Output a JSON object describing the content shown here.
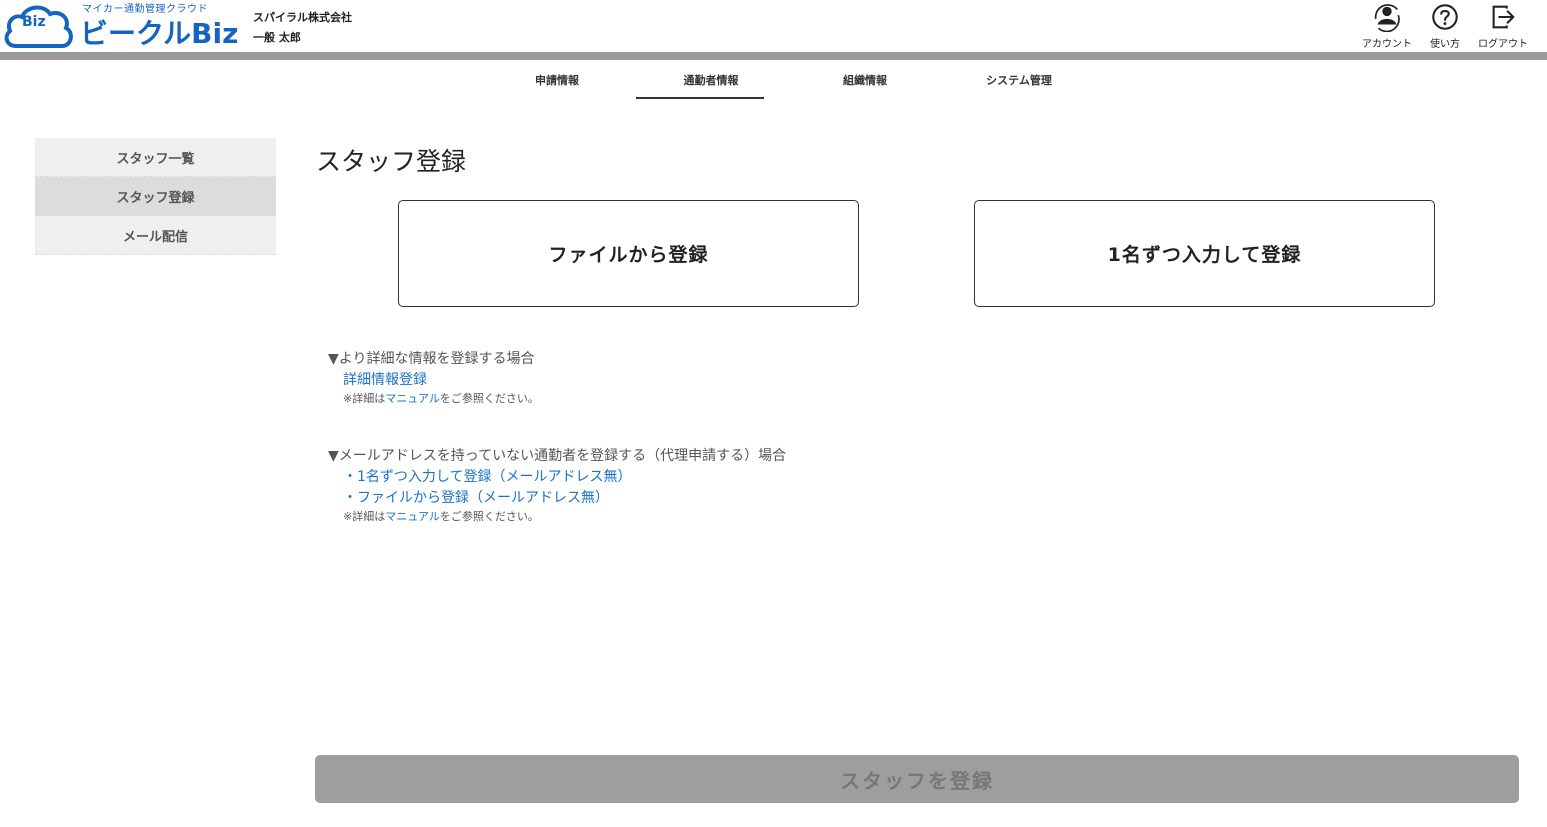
{
  "header": {
    "tagline": "マイカー通勤管理クラウド",
    "brand_name": "ビークルBiz",
    "logo_badge": "Biz",
    "company": "スパイラル株式会社",
    "user": "一般 太郎",
    "account_label": "アカウント",
    "help_label": "使い方",
    "logout_label": "ログアウト"
  },
  "tabs": [
    {
      "label": "申請情報"
    },
    {
      "label": "通勤者情報",
      "active": true
    },
    {
      "label": "組織情報"
    },
    {
      "label": "システム管理"
    }
  ],
  "sidebar": {
    "items": [
      {
        "label": "スタッフ一覧"
      },
      {
        "label": "スタッフ登録",
        "active": true
      },
      {
        "label": "メール配信"
      }
    ]
  },
  "main": {
    "title": "スタッフ登録",
    "cards": {
      "file": "ファイルから登録",
      "single": "1名ずつ入力して登録"
    },
    "detail_section": {
      "heading": "▼より詳細な情報を登録する場合",
      "link": "詳細情報登録",
      "note_prefix": "※詳細は",
      "note_link": "マニュアル",
      "note_suffix": "をご参照ください。"
    },
    "no_email_section": {
      "heading": "▼メールアドレスを持っていない通勤者を登録する（代理申請する）場合",
      "link_single": "・1名ずつ入力して登録（メールアドレス無）",
      "link_file": "・ファイルから登録（メールアドレス無）",
      "note_prefix": "※詳細は",
      "note_link": "マニュアル",
      "note_suffix": "をご参照ください。"
    },
    "submit_label": "スタッフを登録"
  },
  "colors": {
    "brand": "#1565c0",
    "link": "#1a73c8",
    "header_bar": "#9a9a9a",
    "submit_disabled": "#9e9e9e"
  }
}
